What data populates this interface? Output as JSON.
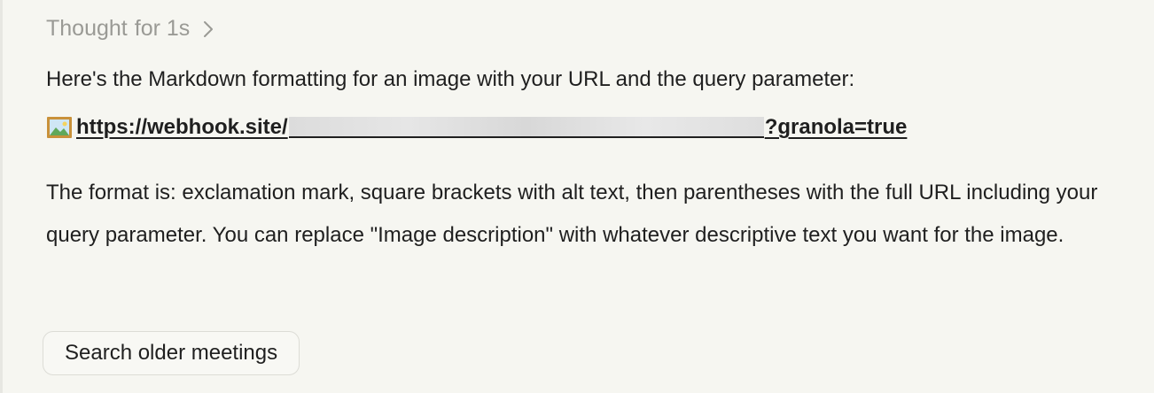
{
  "thought": {
    "label": "Thought",
    "duration": "for 1s"
  },
  "response": {
    "intro": "Here's the Markdown formatting for an image with your URL and the query parameter:",
    "link_prefix": "https://webhook.site/",
    "link_suffix": "?granola=true",
    "explanation": "The format is: exclamation mark, square brackets with alt text, then parentheses with the full URL including your query parameter. You can replace \"Image description\" with whatever descriptive text you want for the image."
  },
  "actions": {
    "search_older_label": "Search older meetings"
  },
  "icons": {
    "thought_toggle": "chevron-right-icon",
    "link_image": "image-icon"
  }
}
